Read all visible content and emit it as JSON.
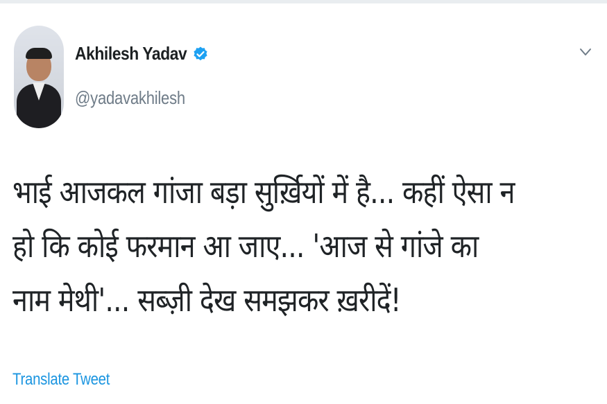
{
  "tweet": {
    "author_name": "Akhilesh Yadav",
    "handle": "@yadavakhilesh",
    "verified": true,
    "verified_color": "#1da1f2",
    "text": "भाई आजकल गांजा बड़ा सुर्ख़ियों में है... कहीं ऐसा न हो कि कोई फरमान आ जाए... 'आज से गांजे का नाम मेथी'... सब्ज़ी देख समझकर ख़रीदें!",
    "translate_label": "Translate Tweet",
    "link_color": "#1b95e0",
    "menu_icon": "chevron-down-icon",
    "avatar_icon": "profile-photo"
  }
}
